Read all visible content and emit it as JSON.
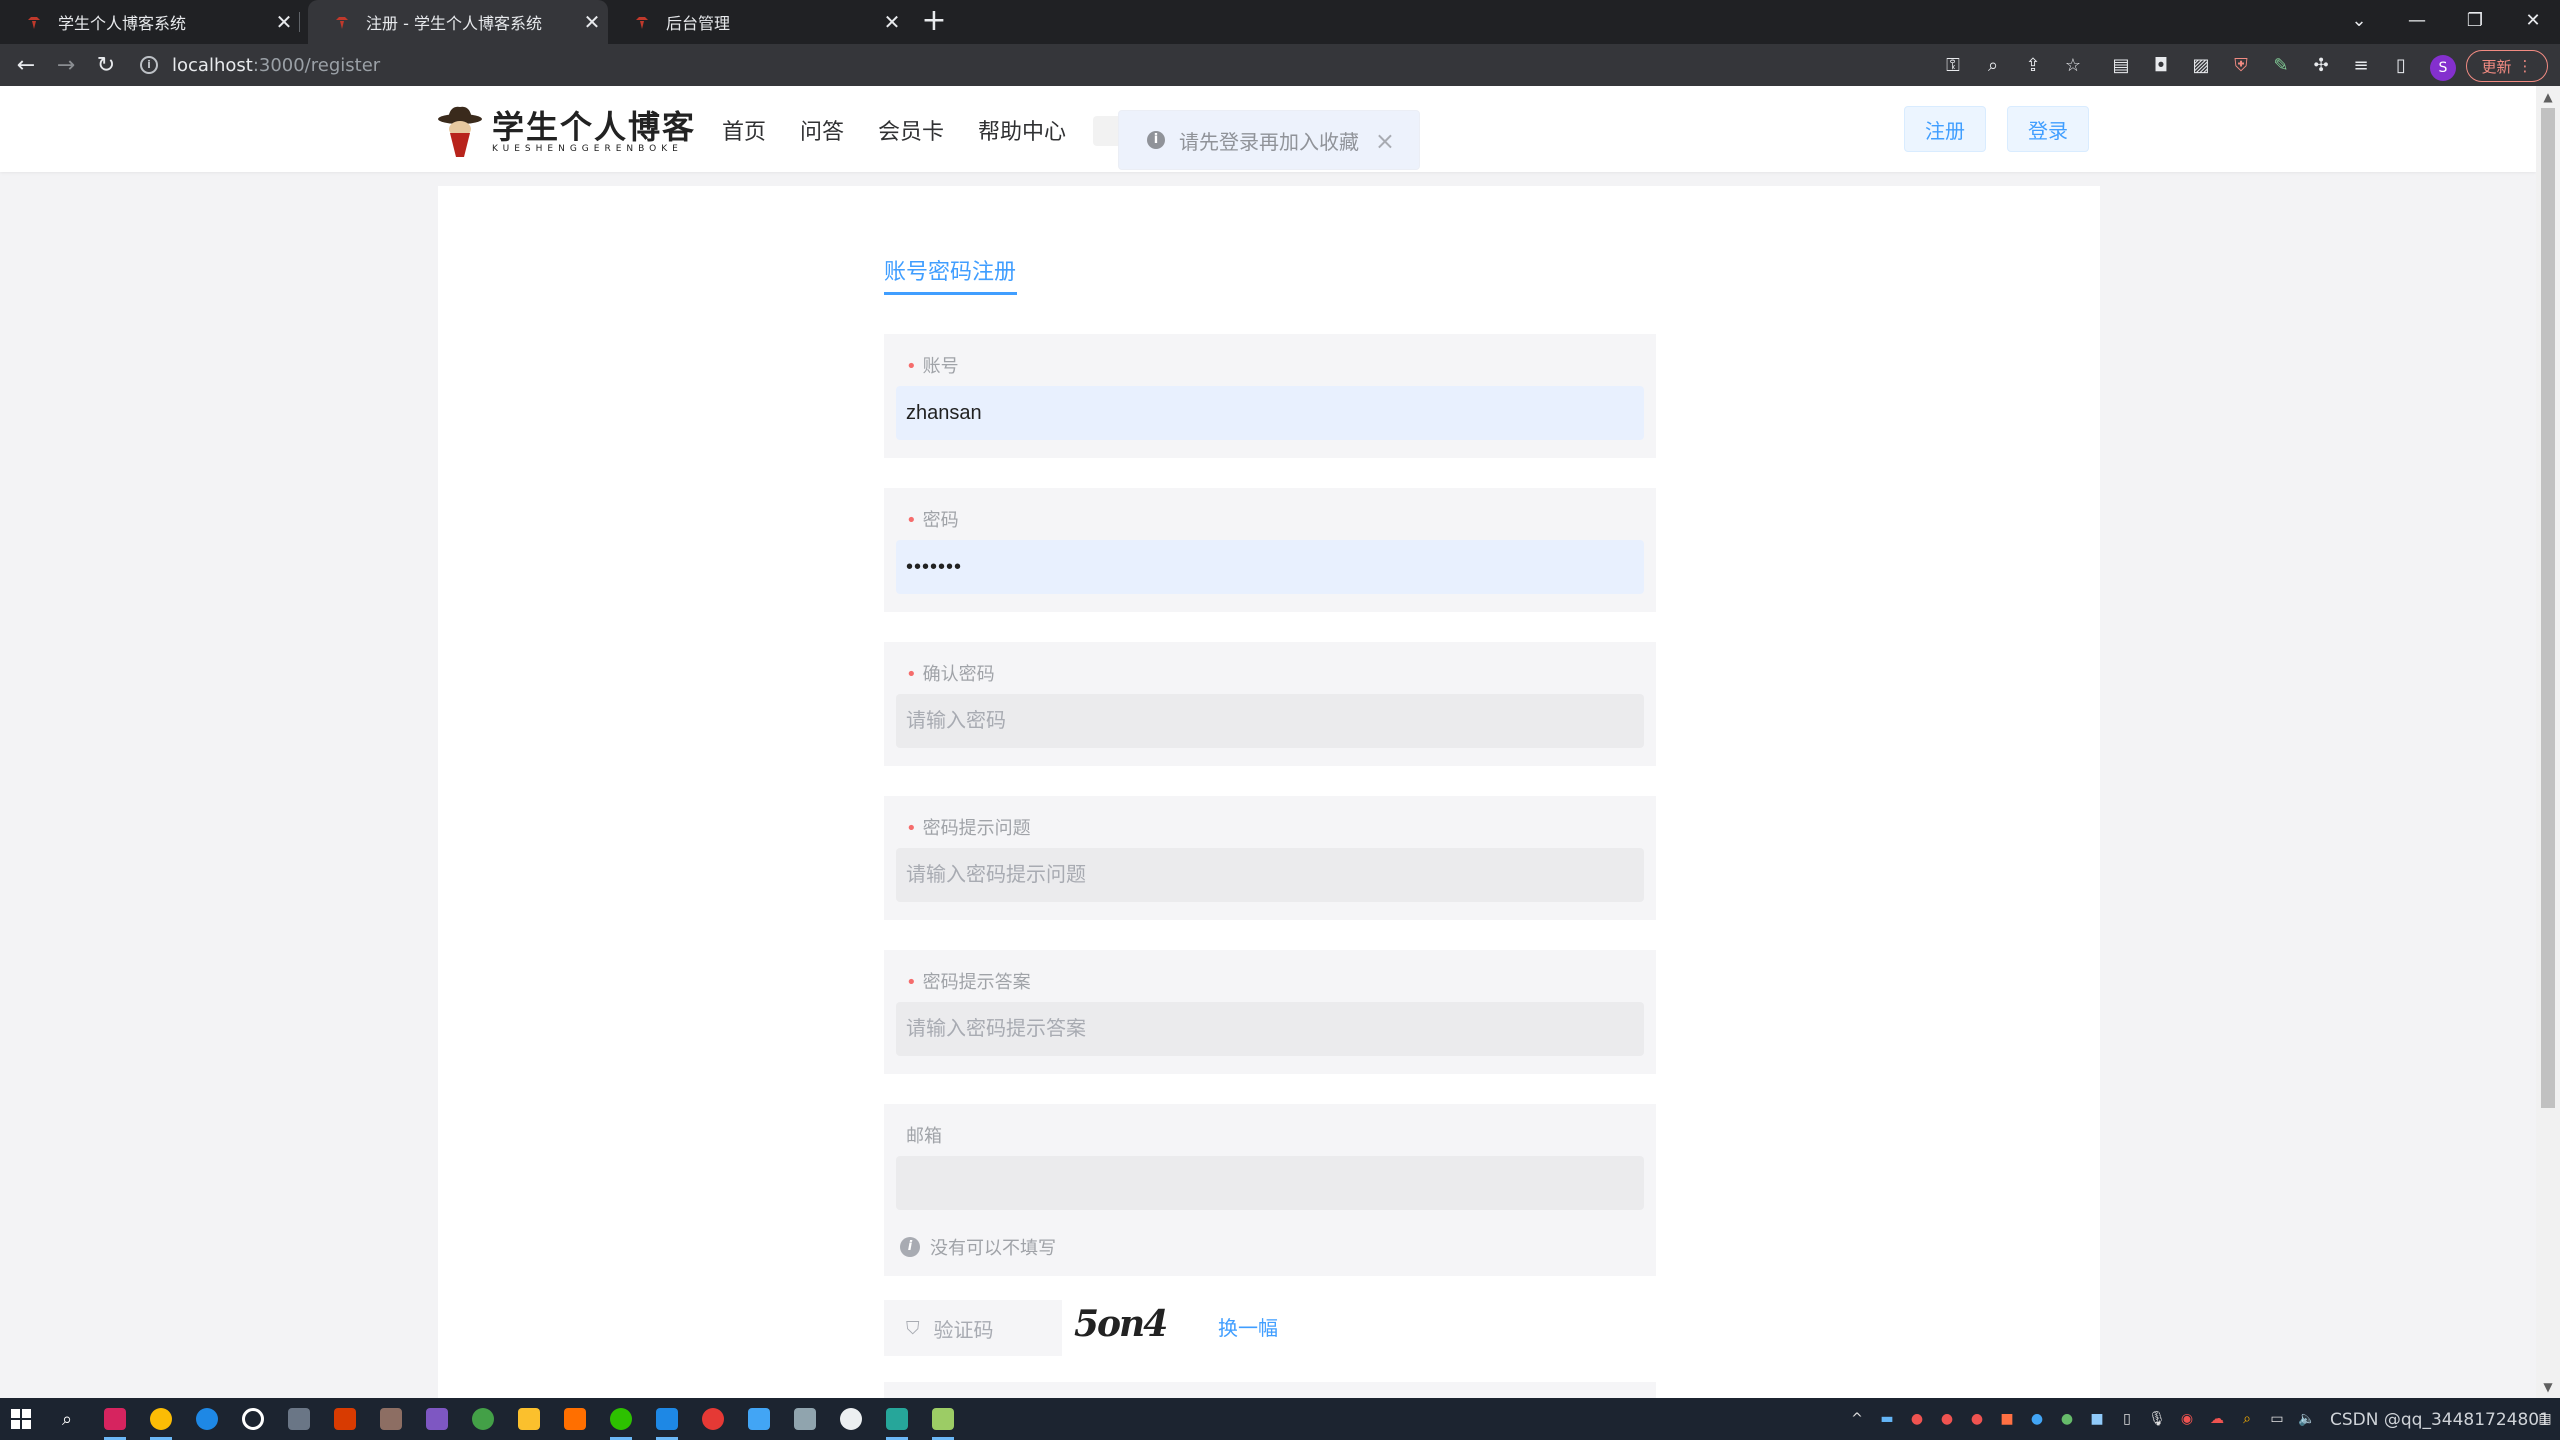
{
  "browser": {
    "tabs": [
      {
        "title": "学生个人博客系统",
        "active": false
      },
      {
        "title": "注册 - 学生个人博客系统",
        "active": true
      },
      {
        "title": "后台管理",
        "active": false
      }
    ],
    "url_host": "localhost",
    "url_path": ":3000/register",
    "profile_initial": "S",
    "update_label": "更新"
  },
  "site": {
    "logo_cn": "学生个人博客",
    "logo_en": "KUESHENGGERENBOKE",
    "menu": [
      "首页",
      "问答",
      "会员卡",
      "帮助中心"
    ],
    "register_label": "注册",
    "login_label": "登录",
    "toast": "请先登录再加入收藏"
  },
  "form": {
    "tab_title": "账号密码注册",
    "account": {
      "label": "账号",
      "value": "zhansan",
      "placeholder": ""
    },
    "password": {
      "label": "密码",
      "value": "•••••••",
      "placeholder": ""
    },
    "confirm": {
      "label": "确认密码",
      "placeholder": "请输入密码"
    },
    "question": {
      "label": "密码提示问题",
      "placeholder": "请输入密码提示问题"
    },
    "answer": {
      "label": "密码提示答案",
      "placeholder": "请输入密码提示答案"
    },
    "email": {
      "label": "邮箱",
      "placeholder": "",
      "hint": "没有可以不填写"
    },
    "captcha": {
      "placeholder": "验证码",
      "image_text": "5on4",
      "refresh": "换一幅"
    }
  },
  "taskbar": {
    "tray_text": "CSDN @qq_34481724801"
  },
  "colors": {
    "accent": "#409eff",
    "required": "#f56c6c",
    "field_bg": "#f5f5f7",
    "autofill_bg": "#e8f0fe"
  }
}
